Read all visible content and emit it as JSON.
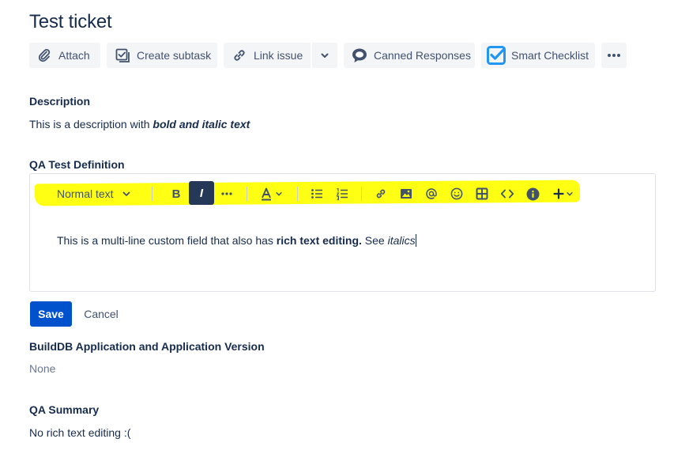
{
  "issue": {
    "title": "Test ticket"
  },
  "toolbar": {
    "attach": {
      "label": "Attach",
      "icon": "paperclip-icon"
    },
    "create_subtask": {
      "label": "Create subtask",
      "icon": "subtask-icon"
    },
    "link_issue": {
      "label": "Link issue",
      "icon": "link-icon"
    },
    "canned_responses": {
      "label": "Canned Responses",
      "icon": "speech-bubble-icon"
    },
    "smart_checklist": {
      "label": "Smart Checklist",
      "icon": "checklist-icon",
      "color": "#2196f3"
    },
    "more": {
      "icon": "more-icon"
    }
  },
  "description": {
    "label": "Description",
    "text_prefix": "This is a description with ",
    "text_bold_italic": "bold and italic text"
  },
  "qa_test_definition": {
    "label": "QA Test Definition",
    "editor_toolbar": {
      "text_style": "Normal text",
      "bold": "B",
      "italic": "I",
      "active_tool": "italic",
      "highlight_color": "#ffff00"
    },
    "content": {
      "part1": "This is a multi-line custom field that also has ",
      "part2_bold": "rich text editing.",
      "part3": " See ",
      "part4_italic": "italics"
    }
  },
  "actions": {
    "save": "Save",
    "cancel": "Cancel"
  },
  "builddb": {
    "label": "BuildDB Application and Application Version",
    "value": "None"
  },
  "qa_summary": {
    "label": "QA Summary",
    "value": "No rich text editing :("
  },
  "colors": {
    "primary": "#0052cc",
    "text": "#172b4d",
    "subtle_bg": "#f4f5f7"
  }
}
